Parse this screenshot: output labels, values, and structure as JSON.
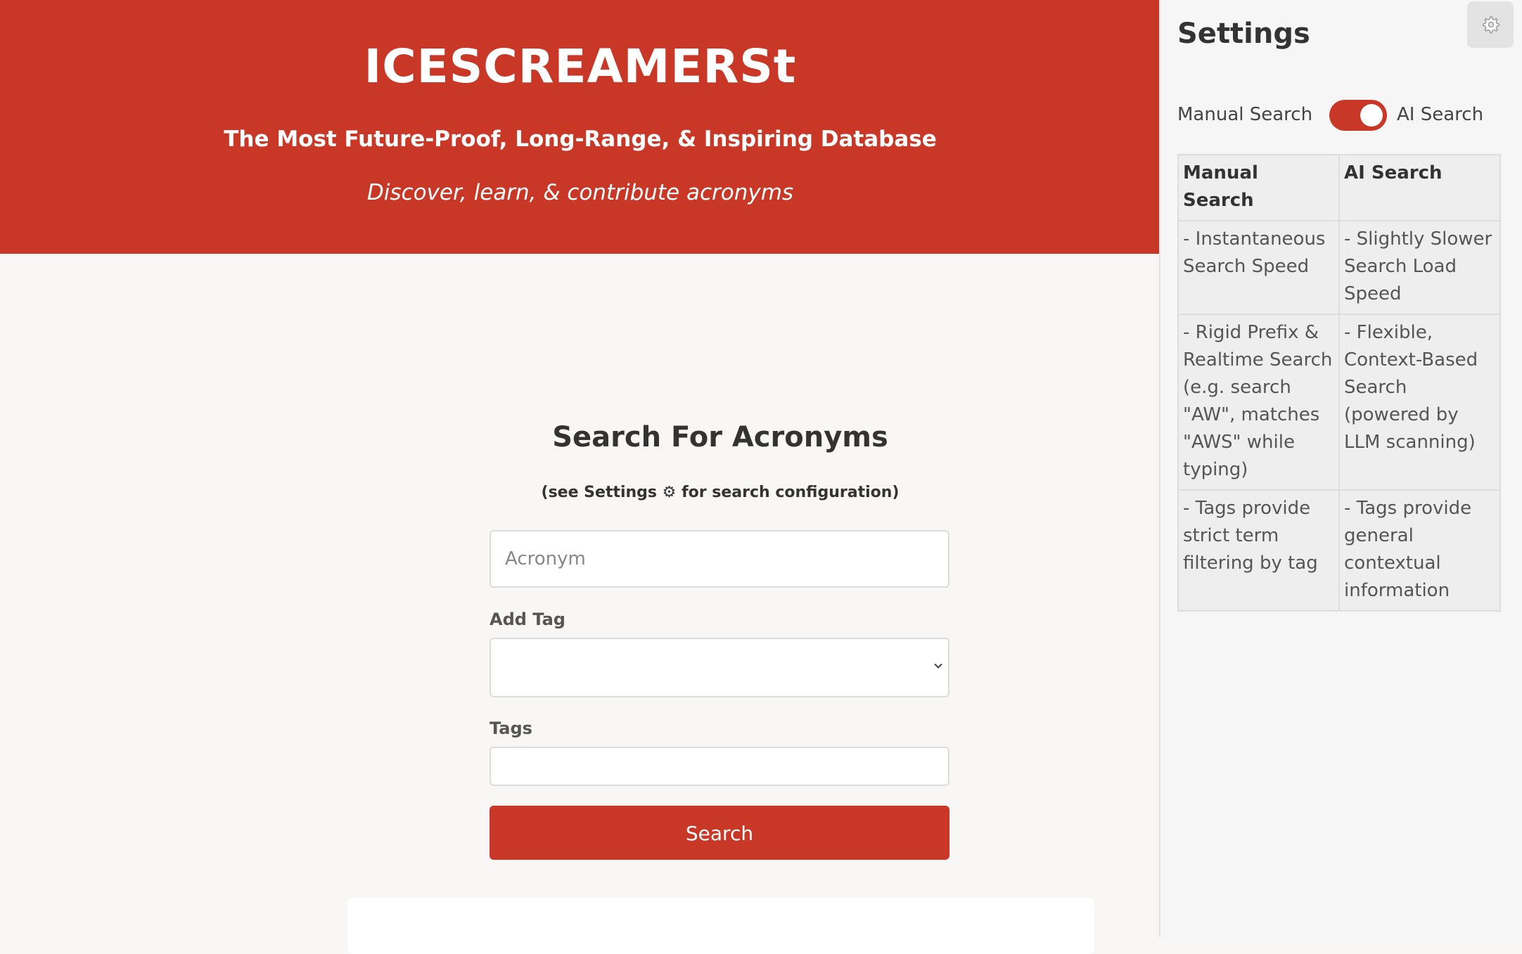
{
  "hero": {
    "title": "ICESCREAMERSt",
    "subtitle": "The Most Future-Proof, Long-Range, & Inspiring Database",
    "tagline": "Discover, learn, & contribute acronyms"
  },
  "search": {
    "heading": "Search For Acronyms",
    "note": "(see Settings ⚙ for search configuration)",
    "acronym_placeholder": "Acronym",
    "acronym_value": "",
    "add_tag_label": "Add Tag",
    "add_tag_selected": "",
    "tags_label": "Tags",
    "tags_value": "",
    "button_label": "Search"
  },
  "settings": {
    "title": "Settings",
    "manual_label": "Manual Search",
    "ai_label": "AI Search",
    "toggle_on": true,
    "table": {
      "headers": [
        "Manual Search",
        "AI Search"
      ],
      "rows": [
        [
          "- Instantaneous Search Speed",
          "- Slightly Slower Search Load Speed"
        ],
        [
          "- Rigid Prefix & Realtime Search (e.g. search \"AW\", matches \"AWS\" while typing)",
          "- Flexible, Context-Based Search (powered by LLM scanning)"
        ],
        [
          "- Tags provide strict term filtering by tag",
          "- Tags provide general contextual information"
        ]
      ]
    }
  },
  "icons": {
    "gear": "gear-icon",
    "chevron": "chevron-down-icon"
  },
  "colors": {
    "brand_red": "#c93726",
    "page_bg": "#f8f7f5",
    "panel_bg": "#f6f6f6"
  }
}
